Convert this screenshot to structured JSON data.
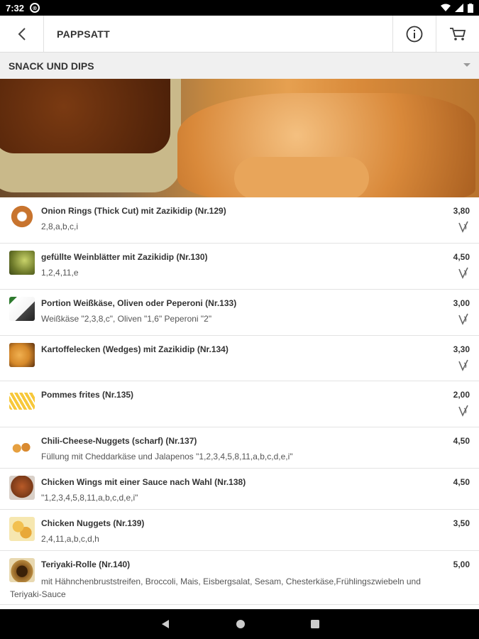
{
  "status": {
    "time": "7:32"
  },
  "appbar": {
    "title": "PAPPSATT"
  },
  "category": {
    "title": "SNACK UND DIPS"
  },
  "items": [
    {
      "name": "Onion Rings (Thick Cut) mit Zazikidip (Nr.129)",
      "price": "3,80",
      "info": "2,8,a,b,c,i",
      "vegetarian": true,
      "thumb_color": "#c8742e"
    },
    {
      "name": "gefüllte Weinblätter mit Zazikidip (Nr.130)",
      "price": "4,50",
      "info": "1,2,4,11,e",
      "vegetarian": true,
      "thumb_color": "#6e7a2a"
    },
    {
      "name": "Portion Weißkäse, Oliven oder Peperoni (Nr.133)",
      "price": "3,00",
      "info": "Weißkäse \"2,3,8,c\", Oliven \"1,6\" Peperoni \"2\"",
      "vegetarian": true,
      "thumb_color": "#d9d9d9"
    },
    {
      "name": "Kartoffelecken (Wedges) mit Zazikidip (Nr.134)",
      "price": "3,30",
      "info": "",
      "vegetarian": true,
      "thumb_color": "#d6892a"
    },
    {
      "name": "Pommes frites (Nr.135)",
      "price": "2,00",
      "info": "",
      "vegetarian": true,
      "thumb_color": "#f0c040"
    },
    {
      "name": "Chili-Cheese-Nuggets (scharf) (Nr.137)",
      "price": "4,50",
      "info": "Füllung mit Cheddarkäse und Jalapenos \"1,2,3,4,5,8,11,a,b,c,d,e,i\"",
      "vegetarian": false,
      "thumb_color": "#e09a3a"
    },
    {
      "name": "Chicken Wings mit einer Sauce nach Wahl (Nr.138)",
      "price": "4,50",
      "info": "\"1,2,3,4,5,8,11,a,b,c,d,e,i\"",
      "vegetarian": false,
      "thumb_color": "#9a4a20"
    },
    {
      "name": "Chicken Nuggets (Nr.139)",
      "price": "3,50",
      "info": "2,4,11,a,b,c,d,h",
      "vegetarian": false,
      "thumb_color": "#e8b040"
    },
    {
      "name": "Teriyaki-Rolle (Nr.140)",
      "price": "5,00",
      "info": "mit Hähnchenbruststreifen, Broccoli, Mais, Eisbergsalat, Sesam, Chesterkäse,Frühlingszwiebeln und",
      "info2": "Teriyaki-Sauce",
      "vegetarian": false,
      "thumb_color": "#8a5a20"
    }
  ],
  "icons": {
    "back": "arrow-left",
    "info": "info-circle",
    "cart": "shopping-cart",
    "vegetarian": "v-leaf"
  }
}
